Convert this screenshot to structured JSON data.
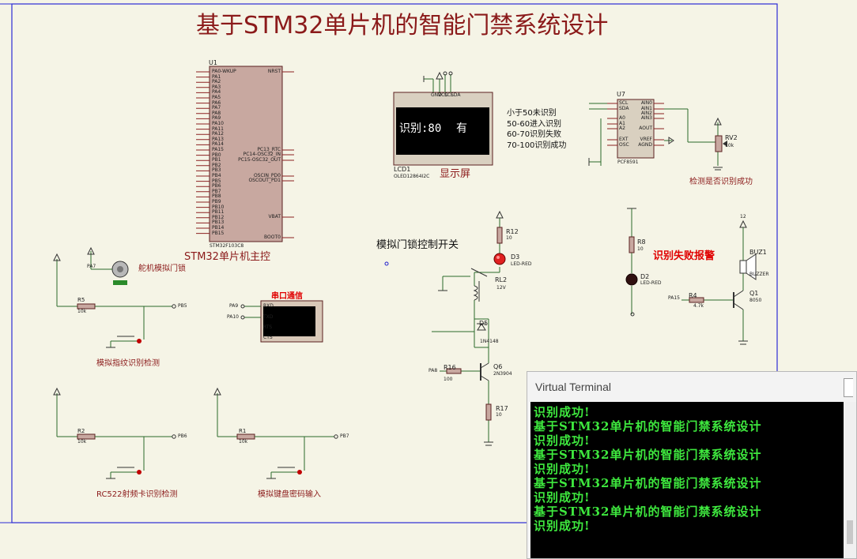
{
  "title": "基于STM32单片机的智能门禁系统设计",
  "mcu": {
    "ref": "U1",
    "part": "STM32F103C8",
    "caption": "STM32单片机主控",
    "left_pins": [
      "PA0-WKUP",
      "PA1",
      "PA2",
      "PA3",
      "PA4",
      "PA5",
      "PA6",
      "PA7",
      "PA8",
      "PA9",
      "PA10",
      "PA11",
      "PA12",
      "PA13",
      "PA14",
      "PA15",
      "PB0",
      "PB1",
      "PB2",
      "PB3",
      "PB4",
      "PB5",
      "PB6",
      "PB7",
      "PB8",
      "PB9",
      "PB10",
      "PB11",
      "PB12",
      "PB13",
      "PB14",
      "PB15"
    ],
    "right_pins": [
      "NRST",
      "PC13_RTC",
      "PC14-OSC32_IN",
      "PC15-OSC32_OUT",
      "OSCIN_PD0",
      "OSCOUT_PD1",
      "VBAT",
      "BOOT0"
    ]
  },
  "lcd": {
    "ref": "LCD1",
    "part": "OLED12864I2C",
    "caption": "显示屏",
    "screen_left": "识别:80",
    "screen_right": "有",
    "pin_labels": [
      "GND",
      "VCC",
      "SCL",
      "SDA"
    ]
  },
  "legend": [
    "小于50未识别",
    "50-60进入识别",
    "60-70识别失败",
    "70-100识别成功"
  ],
  "adc": {
    "ref": "U7",
    "part": "PCF8591",
    "left_pins": [
      "SCL",
      "SDA",
      "A0",
      "A1",
      "A2",
      "EXT",
      "OSC"
    ],
    "right_pins": [
      "AIN0",
      "AIN1",
      "AIN2",
      "AIN3",
      "AOUT",
      "VREF",
      "AGND"
    ],
    "pot_ref": "RV2",
    "pot_value": "10k",
    "caption": "检测是否识别成功"
  },
  "servo": {
    "caption": "舵机模拟门锁",
    "net": "PA7"
  },
  "serial": {
    "caption": "串口通信",
    "pins": [
      "RXD",
      "TXD",
      "RTS",
      "CTS"
    ],
    "nets": [
      "PA9",
      "PA10"
    ]
  },
  "buttons": [
    {
      "res": "R5",
      "value": "10k",
      "net": "PB5",
      "caption": "模拟指纹识别检测"
    },
    {
      "res": "R2",
      "value": "10k",
      "net": "PB6",
      "caption": "RC522射频卡识别检测"
    },
    {
      "res": "R1",
      "value": "10k",
      "net": "PB7",
      "caption": "模拟键盘密码输入"
    }
  ],
  "lock_switch": {
    "caption": "模拟门锁控制开关",
    "r12": "R12",
    "r12_val": "10",
    "led": "D3",
    "led_part": "LED-RED",
    "relay": "RL2",
    "relay_val": "12V",
    "diode": "D5",
    "diode_part": "1N4148",
    "r16": "R16",
    "r16_val": "100",
    "transistor": "Q6",
    "transistor_part": "2N3904",
    "r17": "R17",
    "r17_val": "10",
    "net": "PA8"
  },
  "alarm": {
    "caption": "识别失败报警",
    "r8": "R8",
    "r8_val": "10",
    "led": "D2",
    "led_part": "LED-RED",
    "buzzer": "BUZ1",
    "buzzer_part": "BUZZER",
    "r4": "R4",
    "r4_val": "4.7k",
    "transistor": "Q1",
    "transistor_part": "8050",
    "net": "PA15",
    "vcc": "12"
  },
  "terminal": {
    "window_title": "Virtual Terminal",
    "lines": [
      "识别成功!",
      "基于STM32单片机的智能门禁系统设计",
      "识别成功!",
      "基于STM32单片机的智能门禁系统设计",
      "识别成功!",
      "基于STM32单片机的智能门禁系统设计",
      "识别成功!",
      "基于STM32单片机的智能门禁系统设计",
      "识别成功!"
    ]
  }
}
